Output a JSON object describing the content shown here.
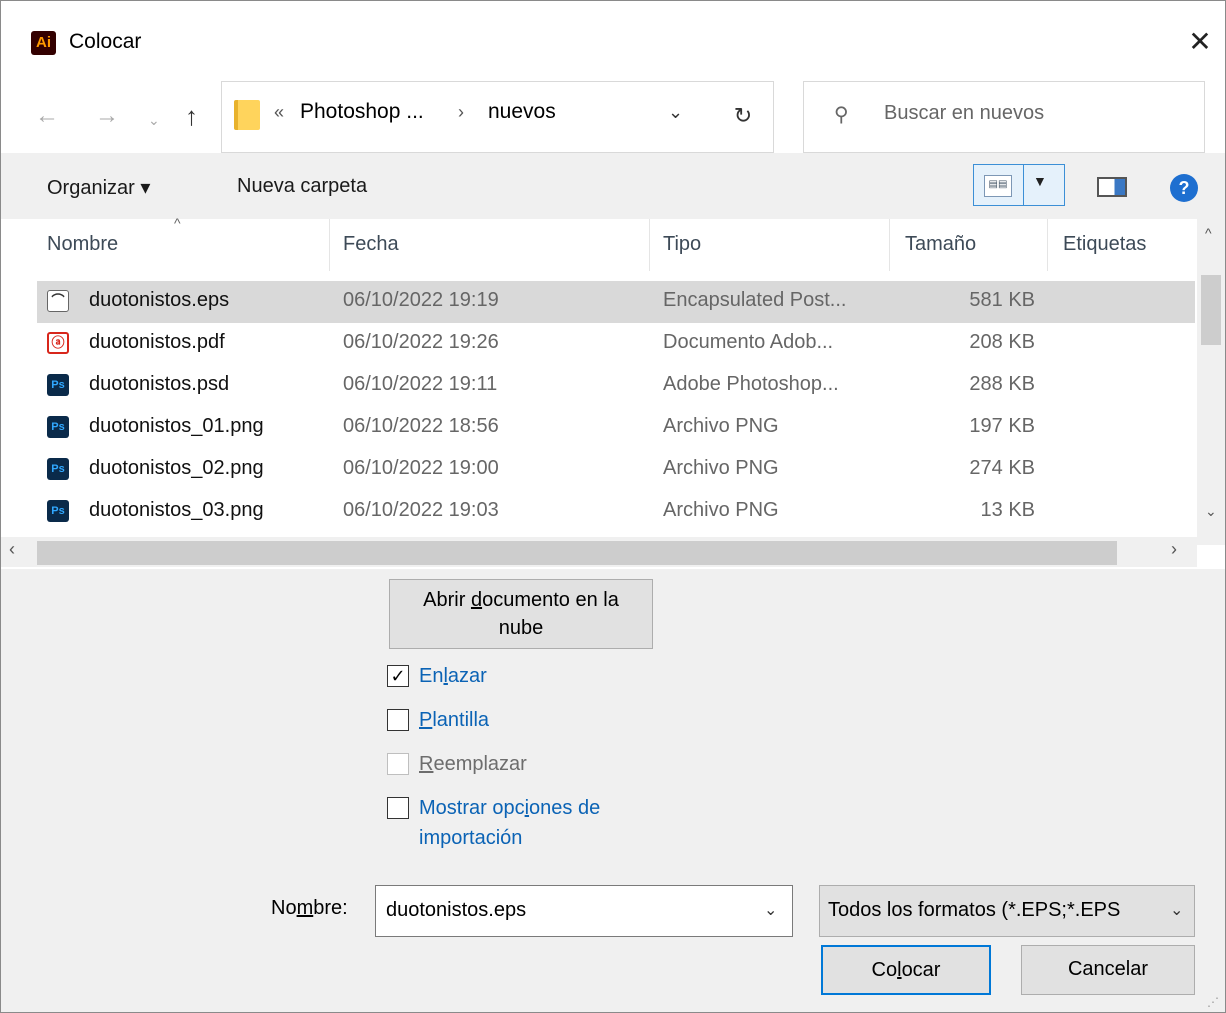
{
  "window": {
    "title": "Colocar",
    "app_icon": "Ai",
    "close_glyph": "✕"
  },
  "nav": {
    "back_glyph": "←",
    "forward_glyph": "→",
    "recent_glyph": "⌄",
    "up_glyph": "↑",
    "breadcrumb_overflow": "«",
    "breadcrumb_parent": "Photoshop ...",
    "breadcrumb_arrow": "›",
    "breadcrumb_current": "nuevos",
    "address_dropdown": "⌄",
    "refresh_glyph": "↻",
    "search_placeholder": "Buscar en nuevos",
    "search_glyph": "⚲"
  },
  "toolbar": {
    "organize": "Organizar ▾",
    "new_folder": "Nueva carpeta",
    "help": "?"
  },
  "columns": {
    "name": "Nombre",
    "date": "Fecha",
    "type": "Tipo",
    "size": "Tamaño",
    "tags": "Etiquetas"
  },
  "files": [
    {
      "name": "duotonistos.eps",
      "date": "06/10/2022 19:19",
      "type": "Encapsulated Post...",
      "size": "581 KB",
      "icon": "eps-icon",
      "icon_text": "⌒"
    },
    {
      "name": "duotonistos.pdf",
      "date": "06/10/2022 19:26",
      "type": "Documento Adob...",
      "size": "208 KB",
      "icon": "pdf-icon",
      "icon_text": "ⓐ"
    },
    {
      "name": "duotonistos.psd",
      "date": "06/10/2022 19:11",
      "type": "Adobe Photoshop...",
      "size": "288 KB",
      "icon": "psd-icon",
      "icon_text": "Ps"
    },
    {
      "name": "duotonistos_01.png",
      "date": "06/10/2022 18:56",
      "type": "Archivo PNG",
      "size": "197 KB",
      "icon": "png-icon",
      "icon_text": "Ps"
    },
    {
      "name": "duotonistos_02.png",
      "date": "06/10/2022 19:00",
      "type": "Archivo PNG",
      "size": "274 KB",
      "icon": "png-icon",
      "icon_text": "Ps"
    },
    {
      "name": "duotonistos_03.png",
      "date": "06/10/2022 19:03",
      "type": "Archivo PNG",
      "size": "13 KB",
      "icon": "png-icon",
      "icon_text": "Ps"
    }
  ],
  "options": {
    "cloud_button_line1_pre": "Abrir ",
    "cloud_button_line1_u": "d",
    "cloud_button_line1_post": "ocumento en la",
    "cloud_button_line2": "nube",
    "link": {
      "pre": "En",
      "u": "l",
      "post": "azar",
      "checked": true,
      "mark": "✓"
    },
    "template": {
      "pre": "",
      "u": "P",
      "post": "lantilla",
      "checked": false
    },
    "replace": {
      "pre": "",
      "u": "R",
      "post": "eemplazar",
      "checked": false,
      "disabled": true
    },
    "import_options": {
      "line1_pre": "Mostrar opc",
      "line1_u": "i",
      "line1_post": "ones de",
      "line2": "importación",
      "checked": false
    }
  },
  "footer": {
    "name_label_pre": "No",
    "name_label_u": "m",
    "name_label_post": "bre:",
    "name_value": "duotonistos.eps",
    "filter_value": "Todos los formatos (*.EPS;*.EPS",
    "dropdown_glyph": "⌄",
    "place_pre": "Co",
    "place_u": "l",
    "place_post": "ocar",
    "cancel": "Cancelar"
  },
  "colors": {
    "link_blue": "#0b63b5",
    "selected_row": "#d9d9d9",
    "primary_border": "#0078d7"
  }
}
